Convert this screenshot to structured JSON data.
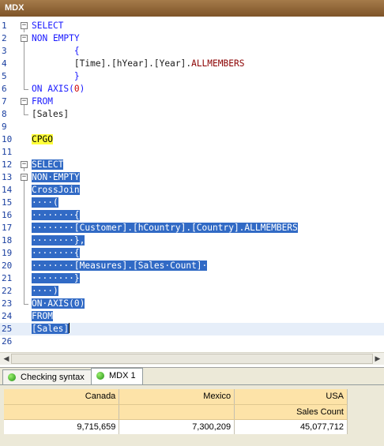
{
  "window": {
    "title": "MDX"
  },
  "editor": {
    "lines": [
      {
        "num": "1",
        "fold": "open",
        "text": "SELECT",
        "style": "kw"
      },
      {
        "num": "2",
        "fold": "open",
        "text": "NON EMPTY",
        "style": "kw"
      },
      {
        "num": "3",
        "fold": "line",
        "text": "        {",
        "style": "kw"
      },
      {
        "num": "4",
        "fold": "line",
        "text": "        [Time].[hYear].[Year].ALLMEMBERS",
        "style": "mixed"
      },
      {
        "num": "5",
        "fold": "line",
        "text": "        }",
        "style": "kw"
      },
      {
        "num": "6",
        "fold": "end",
        "text": "ON AXIS(0)",
        "style": "mixed"
      },
      {
        "num": "7",
        "fold": "open",
        "text": "FROM",
        "style": "kw"
      },
      {
        "num": "8",
        "fold": "end",
        "text": "[Sales]",
        "style": "plain"
      },
      {
        "num": "9",
        "fold": "none",
        "text": "",
        "style": "plain"
      },
      {
        "num": "10",
        "fold": "none",
        "text": "CPGO",
        "style": "go"
      },
      {
        "num": "11",
        "fold": "none",
        "text": "",
        "style": "plain"
      },
      {
        "num": "12",
        "fold": "open",
        "text": "SELECT",
        "style": "hl"
      },
      {
        "num": "13",
        "fold": "open",
        "text": "NON·EMPTY",
        "style": "hl"
      },
      {
        "num": "14",
        "fold": "line",
        "text": "CrossJoin",
        "style": "hl"
      },
      {
        "num": "15",
        "fold": "line",
        "text": "····(",
        "style": "hl"
      },
      {
        "num": "16",
        "fold": "line",
        "text": "········{",
        "style": "hl"
      },
      {
        "num": "17",
        "fold": "line",
        "text": "········[Customer].[hCountry].[Country].ALLMEMBERS",
        "style": "hl"
      },
      {
        "num": "18",
        "fold": "line",
        "text": "········},",
        "style": "hl"
      },
      {
        "num": "19",
        "fold": "line",
        "text": "········{",
        "style": "hl"
      },
      {
        "num": "20",
        "fold": "line",
        "text": "········[Measures].[Sales·Count]·",
        "style": "hl"
      },
      {
        "num": "21",
        "fold": "line",
        "text": "········}",
        "style": "hl"
      },
      {
        "num": "22",
        "fold": "line",
        "text": "····)",
        "style": "hl"
      },
      {
        "num": "23",
        "fold": "end",
        "text": "ON·AXIS(0)",
        "style": "hl"
      },
      {
        "num": "24",
        "fold": "none",
        "text": "FROM",
        "style": "hl"
      },
      {
        "num": "25",
        "fold": "none",
        "text": "[Sales]",
        "style": "hl",
        "current": true
      },
      {
        "num": "26",
        "fold": "none",
        "text": "",
        "style": "plain"
      }
    ]
  },
  "tabs": [
    {
      "label": "Checking syntax",
      "active": false
    },
    {
      "label": "MDX 1",
      "active": true
    }
  ],
  "results": {
    "columns": [
      "Canada",
      "Mexico",
      "USA"
    ],
    "measure": "Sales Count",
    "values": [
      "9,715,659",
      "7,300,209",
      "45,077,712"
    ]
  },
  "colors": {
    "keyword": "#1a1aff",
    "member_function": "#8b0000",
    "selection": "#316ac5",
    "go_highlight": "#ffff3a",
    "header_fill": "#fde3a8"
  }
}
